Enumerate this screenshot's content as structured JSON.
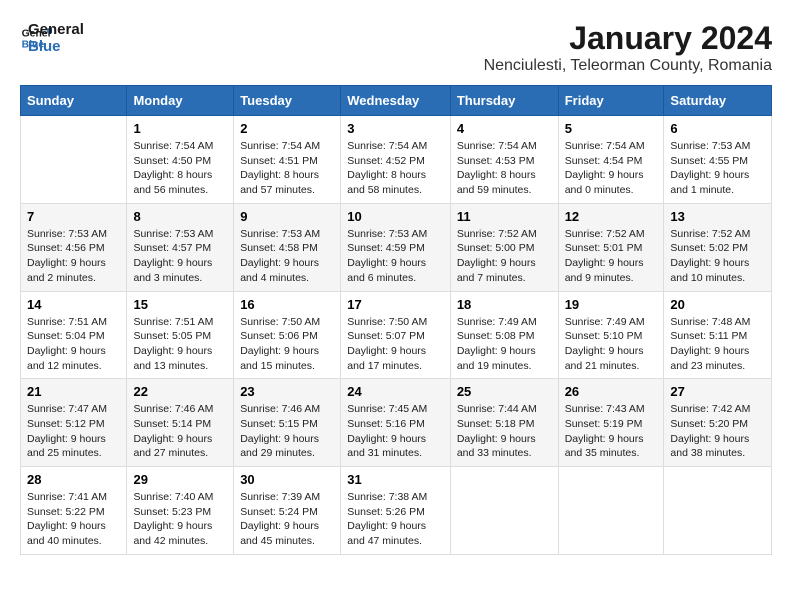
{
  "header": {
    "logo_line1": "General",
    "logo_line2": "Blue",
    "title": "January 2024",
    "subtitle": "Nenciulesti, Teleorman County, Romania"
  },
  "days_of_week": [
    "Sunday",
    "Monday",
    "Tuesday",
    "Wednesday",
    "Thursday",
    "Friday",
    "Saturday"
  ],
  "weeks": [
    [
      {
        "day": "",
        "sunrise": "",
        "sunset": "",
        "daylight": ""
      },
      {
        "day": "1",
        "sunrise": "Sunrise: 7:54 AM",
        "sunset": "Sunset: 4:50 PM",
        "daylight": "Daylight: 8 hours and 56 minutes."
      },
      {
        "day": "2",
        "sunrise": "Sunrise: 7:54 AM",
        "sunset": "Sunset: 4:51 PM",
        "daylight": "Daylight: 8 hours and 57 minutes."
      },
      {
        "day": "3",
        "sunrise": "Sunrise: 7:54 AM",
        "sunset": "Sunset: 4:52 PM",
        "daylight": "Daylight: 8 hours and 58 minutes."
      },
      {
        "day": "4",
        "sunrise": "Sunrise: 7:54 AM",
        "sunset": "Sunset: 4:53 PM",
        "daylight": "Daylight: 8 hours and 59 minutes."
      },
      {
        "day": "5",
        "sunrise": "Sunrise: 7:54 AM",
        "sunset": "Sunset: 4:54 PM",
        "daylight": "Daylight: 9 hours and 0 minutes."
      },
      {
        "day": "6",
        "sunrise": "Sunrise: 7:53 AM",
        "sunset": "Sunset: 4:55 PM",
        "daylight": "Daylight: 9 hours and 1 minute."
      }
    ],
    [
      {
        "day": "7",
        "sunrise": "Sunrise: 7:53 AM",
        "sunset": "Sunset: 4:56 PM",
        "daylight": "Daylight: 9 hours and 2 minutes."
      },
      {
        "day": "8",
        "sunrise": "Sunrise: 7:53 AM",
        "sunset": "Sunset: 4:57 PM",
        "daylight": "Daylight: 9 hours and 3 minutes."
      },
      {
        "day": "9",
        "sunrise": "Sunrise: 7:53 AM",
        "sunset": "Sunset: 4:58 PM",
        "daylight": "Daylight: 9 hours and 4 minutes."
      },
      {
        "day": "10",
        "sunrise": "Sunrise: 7:53 AM",
        "sunset": "Sunset: 4:59 PM",
        "daylight": "Daylight: 9 hours and 6 minutes."
      },
      {
        "day": "11",
        "sunrise": "Sunrise: 7:52 AM",
        "sunset": "Sunset: 5:00 PM",
        "daylight": "Daylight: 9 hours and 7 minutes."
      },
      {
        "day": "12",
        "sunrise": "Sunrise: 7:52 AM",
        "sunset": "Sunset: 5:01 PM",
        "daylight": "Daylight: 9 hours and 9 minutes."
      },
      {
        "day": "13",
        "sunrise": "Sunrise: 7:52 AM",
        "sunset": "Sunset: 5:02 PM",
        "daylight": "Daylight: 9 hours and 10 minutes."
      }
    ],
    [
      {
        "day": "14",
        "sunrise": "Sunrise: 7:51 AM",
        "sunset": "Sunset: 5:04 PM",
        "daylight": "Daylight: 9 hours and 12 minutes."
      },
      {
        "day": "15",
        "sunrise": "Sunrise: 7:51 AM",
        "sunset": "Sunset: 5:05 PM",
        "daylight": "Daylight: 9 hours and 13 minutes."
      },
      {
        "day": "16",
        "sunrise": "Sunrise: 7:50 AM",
        "sunset": "Sunset: 5:06 PM",
        "daylight": "Daylight: 9 hours and 15 minutes."
      },
      {
        "day": "17",
        "sunrise": "Sunrise: 7:50 AM",
        "sunset": "Sunset: 5:07 PM",
        "daylight": "Daylight: 9 hours and 17 minutes."
      },
      {
        "day": "18",
        "sunrise": "Sunrise: 7:49 AM",
        "sunset": "Sunset: 5:08 PM",
        "daylight": "Daylight: 9 hours and 19 minutes."
      },
      {
        "day": "19",
        "sunrise": "Sunrise: 7:49 AM",
        "sunset": "Sunset: 5:10 PM",
        "daylight": "Daylight: 9 hours and 21 minutes."
      },
      {
        "day": "20",
        "sunrise": "Sunrise: 7:48 AM",
        "sunset": "Sunset: 5:11 PM",
        "daylight": "Daylight: 9 hours and 23 minutes."
      }
    ],
    [
      {
        "day": "21",
        "sunrise": "Sunrise: 7:47 AM",
        "sunset": "Sunset: 5:12 PM",
        "daylight": "Daylight: 9 hours and 25 minutes."
      },
      {
        "day": "22",
        "sunrise": "Sunrise: 7:46 AM",
        "sunset": "Sunset: 5:14 PM",
        "daylight": "Daylight: 9 hours and 27 minutes."
      },
      {
        "day": "23",
        "sunrise": "Sunrise: 7:46 AM",
        "sunset": "Sunset: 5:15 PM",
        "daylight": "Daylight: 9 hours and 29 minutes."
      },
      {
        "day": "24",
        "sunrise": "Sunrise: 7:45 AM",
        "sunset": "Sunset: 5:16 PM",
        "daylight": "Daylight: 9 hours and 31 minutes."
      },
      {
        "day": "25",
        "sunrise": "Sunrise: 7:44 AM",
        "sunset": "Sunset: 5:18 PM",
        "daylight": "Daylight: 9 hours and 33 minutes."
      },
      {
        "day": "26",
        "sunrise": "Sunrise: 7:43 AM",
        "sunset": "Sunset: 5:19 PM",
        "daylight": "Daylight: 9 hours and 35 minutes."
      },
      {
        "day": "27",
        "sunrise": "Sunrise: 7:42 AM",
        "sunset": "Sunset: 5:20 PM",
        "daylight": "Daylight: 9 hours and 38 minutes."
      }
    ],
    [
      {
        "day": "28",
        "sunrise": "Sunrise: 7:41 AM",
        "sunset": "Sunset: 5:22 PM",
        "daylight": "Daylight: 9 hours and 40 minutes."
      },
      {
        "day": "29",
        "sunrise": "Sunrise: 7:40 AM",
        "sunset": "Sunset: 5:23 PM",
        "daylight": "Daylight: 9 hours and 42 minutes."
      },
      {
        "day": "30",
        "sunrise": "Sunrise: 7:39 AM",
        "sunset": "Sunset: 5:24 PM",
        "daylight": "Daylight: 9 hours and 45 minutes."
      },
      {
        "day": "31",
        "sunrise": "Sunrise: 7:38 AM",
        "sunset": "Sunset: 5:26 PM",
        "daylight": "Daylight: 9 hours and 47 minutes."
      },
      {
        "day": "",
        "sunrise": "",
        "sunset": "",
        "daylight": ""
      },
      {
        "day": "",
        "sunrise": "",
        "sunset": "",
        "daylight": ""
      },
      {
        "day": "",
        "sunrise": "",
        "sunset": "",
        "daylight": ""
      }
    ]
  ]
}
